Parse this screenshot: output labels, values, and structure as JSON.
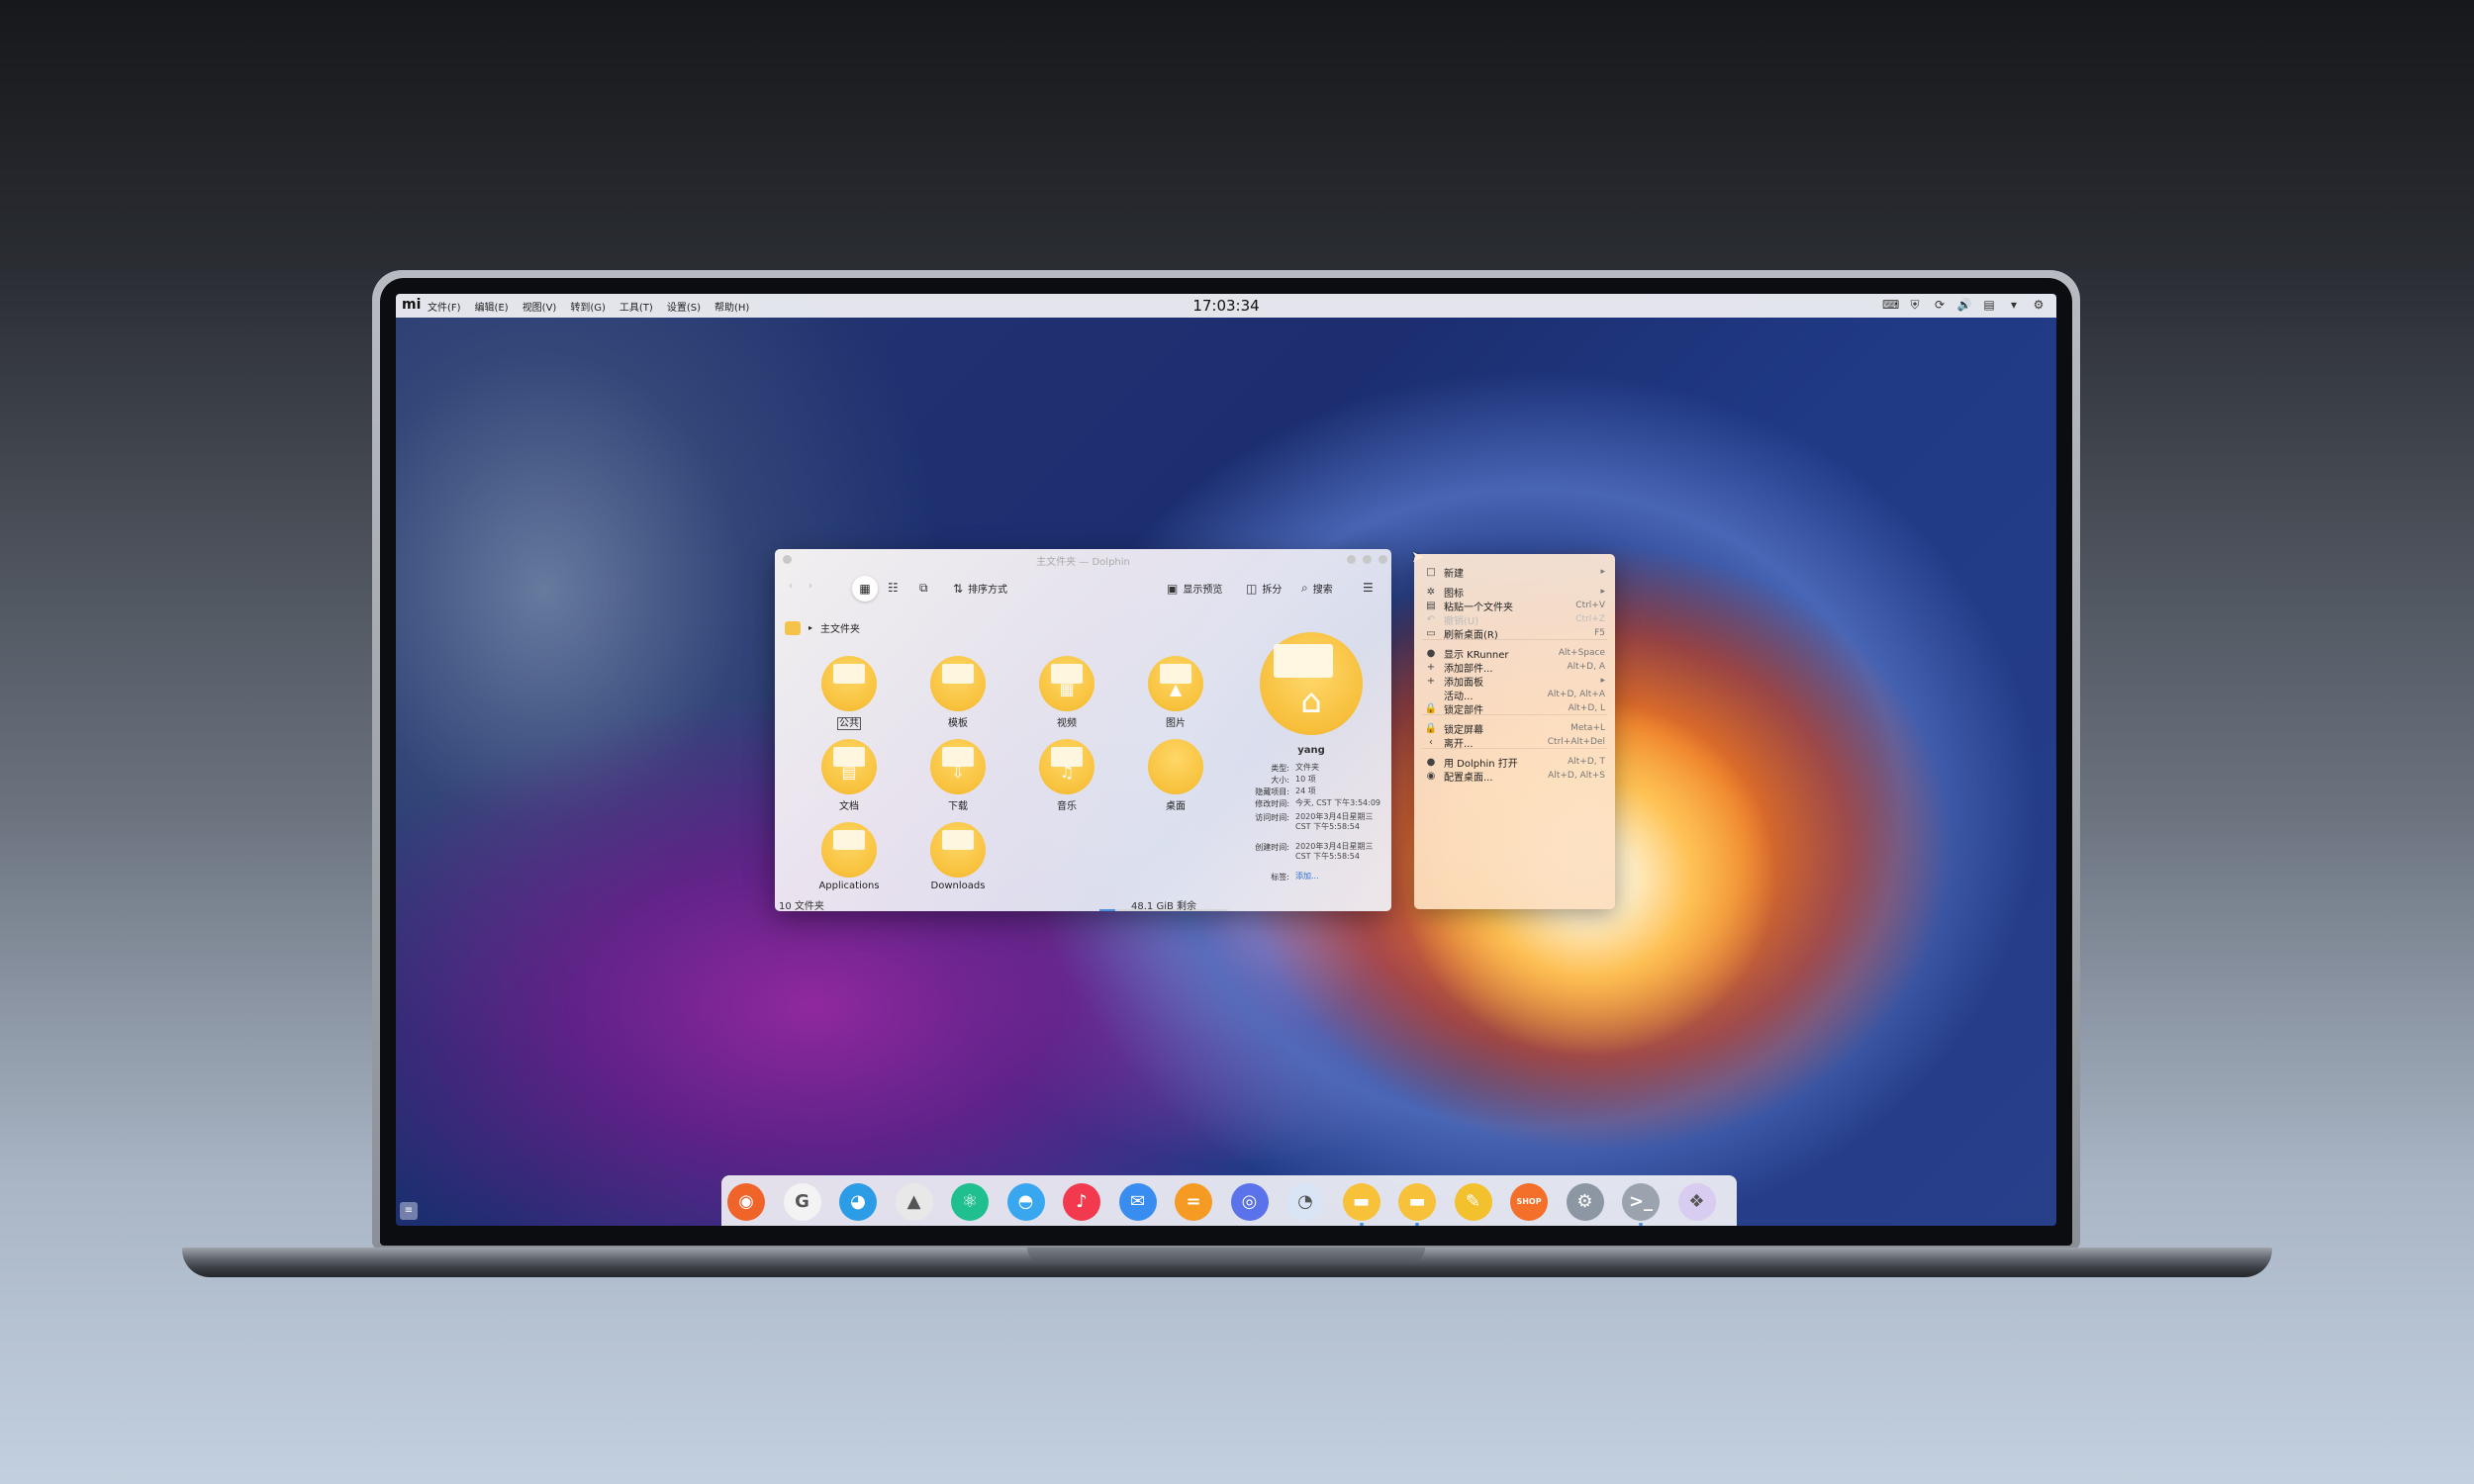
{
  "top_panel": {
    "logo": "mi",
    "menu": [
      "文件(F)",
      "编辑(E)",
      "视图(V)",
      "转到(G)",
      "工具(T)",
      "设置(S)",
      "帮助(H)"
    ],
    "clock": "17:03:34"
  },
  "dolphin": {
    "title": "主文件夹 — Dolphin",
    "toolbar": {
      "sort": "排序方式",
      "preview": "显示预览",
      "split": "拆分",
      "search": "搜索"
    },
    "breadcrumb": "主文件夹",
    "files": [
      {
        "name": "公共",
        "glyph": ""
      },
      {
        "name": "模板",
        "glyph": ""
      },
      {
        "name": "视频",
        "glyph": "▦"
      },
      {
        "name": "图片",
        "glyph": "▲"
      },
      {
        "name": "文档",
        "glyph": "▤"
      },
      {
        "name": "下载",
        "glyph": "⇩"
      },
      {
        "name": "音乐",
        "glyph": "♫"
      },
      {
        "name": "桌面",
        "glyph": ""
      },
      {
        "name": "Applications",
        "glyph": ""
      },
      {
        "name": "Downloads",
        "glyph": ""
      }
    ],
    "info": {
      "name": "yang",
      "rows": [
        {
          "k": "类型:",
          "v": "文件夹"
        },
        {
          "k": "大小:",
          "v": "10 项"
        },
        {
          "k": "隐藏项目:",
          "v": "24 项"
        },
        {
          "k": "修改时间:",
          "v": "今天, CST 下午3:54:09"
        },
        {
          "k": "访问时间:",
          "v": "2020年3月4日星期三 CST 下午5:58:54"
        },
        {
          "k": "创建时间:",
          "v": "2020年3月4日星期三 CST 下午5:58:54"
        },
        {
          "k": "标签:",
          "v": "添加..."
        }
      ]
    },
    "status": {
      "count": "10 文件夹",
      "free": "48.1 GiB 剩余",
      "used_fraction": 0.12
    }
  },
  "context_menu": {
    "items": [
      {
        "label": "新建",
        "shortcut": "▸",
        "icon": "□",
        "disabled": false
      },
      {
        "label": "图标",
        "shortcut": "▸",
        "icon": "✲",
        "disabled": false
      },
      {
        "label": "粘贴一个文件夹",
        "shortcut": "Ctrl+V",
        "icon": "▤",
        "disabled": false
      },
      {
        "label": "撤销(U)",
        "shortcut": "Ctrl+Z",
        "icon": "↶",
        "disabled": true
      },
      {
        "label": "刷新桌面(R)",
        "shortcut": "F5",
        "icon": "▭",
        "disabled": false
      },
      {
        "label": "显示 KRunner",
        "shortcut": "Alt+Space",
        "icon": "●",
        "disabled": false
      },
      {
        "label": "添加部件...",
        "shortcut": "Alt+D, A",
        "icon": "+",
        "disabled": false
      },
      {
        "label": "添加面板",
        "shortcut": "▸",
        "icon": "+",
        "disabled": false
      },
      {
        "label": "活动...",
        "shortcut": "Alt+D, Alt+A",
        "icon": "",
        "disabled": false
      },
      {
        "label": "锁定部件",
        "shortcut": "Alt+D, L",
        "icon": "🔒",
        "disabled": false
      },
      {
        "label": "锁定屏幕",
        "shortcut": "Meta+L",
        "icon": "🔒",
        "disabled": false
      },
      {
        "label": "离开...",
        "shortcut": "Ctrl+Alt+Del",
        "icon": "‹",
        "disabled": false
      },
      {
        "label": "用 Dolphin 打开",
        "shortcut": "Alt+D, T",
        "icon": "●",
        "disabled": false
      },
      {
        "label": "配置桌面...",
        "shortcut": "Alt+D, Alt+S",
        "icon": "◉",
        "disabled": false
      }
    ]
  },
  "dock": {
    "apps": [
      {
        "name": "firefox-icon",
        "glyph": "◉",
        "color": "#f0642a"
      },
      {
        "name": "google-chrome-icon",
        "glyph": "G",
        "color": "#f3f3f3"
      },
      {
        "name": "github-icon",
        "glyph": "◕",
        "color": "#2c9ce6"
      },
      {
        "name": "inkscape-icon",
        "glyph": "▲",
        "color": "#e8e8e8"
      },
      {
        "name": "atom-icon",
        "glyph": "⚛",
        "color": "#1fbf8f"
      },
      {
        "name": "qq-icon",
        "glyph": "◓",
        "color": "#39a7f0"
      },
      {
        "name": "music-icon",
        "glyph": "♪",
        "color": "#f2394e"
      },
      {
        "name": "mail-icon",
        "glyph": "✉",
        "color": "#3a8df0"
      },
      {
        "name": "calculator-icon",
        "glyph": "=",
        "color": "#f59a23"
      },
      {
        "name": "screenshot-icon",
        "glyph": "◎",
        "color": "#5a72ea"
      },
      {
        "name": "system-monitor-icon",
        "glyph": "◔",
        "color": "#d9e4f5"
      },
      {
        "name": "folder-icon",
        "glyph": "▬",
        "color": "#f7c13a"
      },
      {
        "name": "home-folder-icon",
        "glyph": "▬",
        "color": "#f7c13a"
      },
      {
        "name": "notes-icon",
        "glyph": "✎",
        "color": "#f4c12e"
      },
      {
        "name": "shop-icon",
        "glyph": "SHOP",
        "color": "#f46f2a"
      },
      {
        "name": "settings-icon",
        "glyph": "⚙",
        "color": "#8d96a3"
      },
      {
        "name": "terminal-icon",
        "glyph": ">_",
        "color": "#9aa3ae"
      },
      {
        "name": "launcher-icon",
        "glyph": "❖",
        "color": "#d8ccf0"
      }
    ],
    "running": [
      11,
      12,
      16
    ]
  }
}
